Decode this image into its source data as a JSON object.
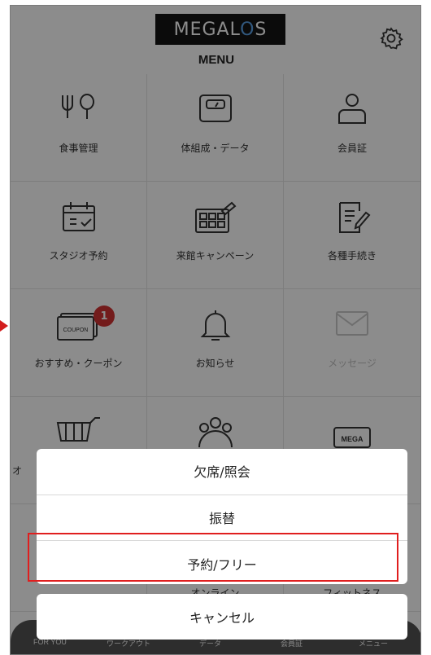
{
  "header": {
    "logo_text": "MEGALOS",
    "title": "MENU",
    "settings_icon": "gear-icon"
  },
  "menu": {
    "items": [
      {
        "label": "食事管理",
        "icon": "fork-spoon-icon"
      },
      {
        "label": "体組成・データ",
        "icon": "scale-icon"
      },
      {
        "label": "会員証",
        "icon": "person-icon"
      },
      {
        "label": "スタジオ予約",
        "icon": "calendar-icon"
      },
      {
        "label": "来館キャンペーン",
        "icon": "stamp-card-icon"
      },
      {
        "label": "各種手続き",
        "icon": "document-edit-icon"
      },
      {
        "label": "おすすめ・クーポン",
        "icon": "coupon-icon",
        "badge": "1",
        "coupon_text": "COUPON"
      },
      {
        "label": "お知らせ",
        "icon": "bell-icon"
      },
      {
        "label": "メッセージ",
        "icon": "mail-icon",
        "disabled": true
      },
      {
        "label": "オ",
        "icon": "cart-icon"
      },
      {
        "label": "",
        "icon": "group-icon"
      },
      {
        "label": "",
        "icon": "mega-icon",
        "icon_text": "MEGA"
      }
    ],
    "partial_row_labels": [
      "オンライン",
      "フィットネス"
    ]
  },
  "action_sheet": {
    "options": [
      "欠席/照会",
      "振替",
      "予約/フリー"
    ],
    "cancel_label": "キャンセル",
    "highlighted_option": "予約/フリー"
  },
  "bottom_nav": {
    "items": [
      "FOR YOU",
      "ワークアウト",
      "データ",
      "会員証",
      "メニュー"
    ]
  },
  "colors": {
    "badge": "#d23232",
    "highlight_border": "#e01e1e",
    "overlay": "rgba(0,0,0,0.45)"
  }
}
